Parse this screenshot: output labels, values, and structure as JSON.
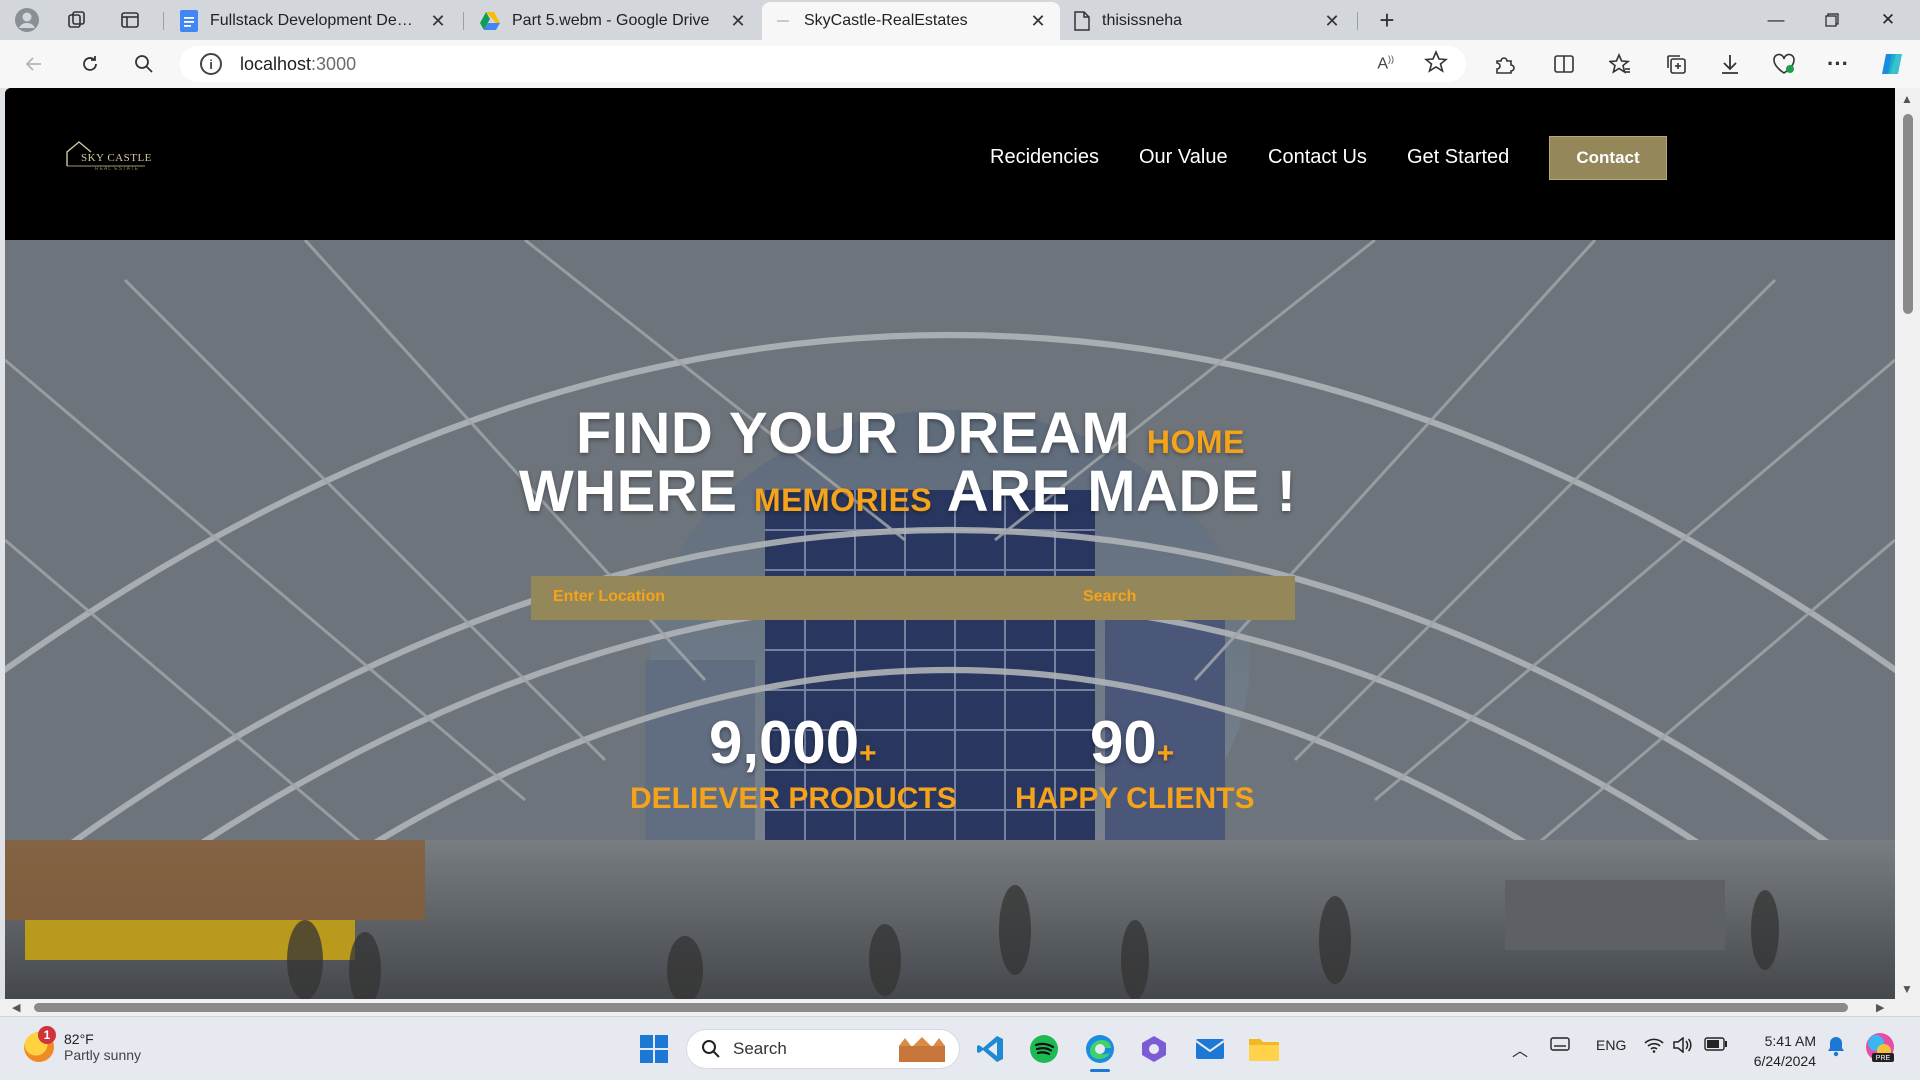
{
  "browser": {
    "tabs": [
      {
        "title": "Fullstack Development Desi QnA",
        "icon": "google-docs-icon"
      },
      {
        "title": "Part 5.webm - Google Drive",
        "icon": "google-drive-icon"
      },
      {
        "title": "SkyCastle-RealEstates",
        "icon": "page-loading-icon",
        "active": true
      },
      {
        "title": "thisissneha",
        "icon": "document-icon"
      }
    ],
    "address": {
      "host": "localhost",
      "port": ":3000"
    }
  },
  "site": {
    "logo": {
      "name": "SKY CASTLE",
      "tagline": "REAL ESTATE"
    },
    "nav": [
      "Recidencies",
      "Our Value",
      "Contact Us",
      "Get Started"
    ],
    "contact_button": "Contact",
    "hero": {
      "line1": "FIND YOUR DREAM",
      "line1_accent": "HOME",
      "line2_start": "WHERE",
      "line2_accent": "MEMORIES",
      "line2_end": "ARE MADE !",
      "search_placeholder": "Enter Location",
      "search_button": "Search"
    },
    "stats": [
      {
        "value": "9,000",
        "plus": "+",
        "label": "DELIEVER PRODUCTS"
      },
      {
        "value": "90",
        "plus": "+",
        "label": "HAPPY CLIENTS"
      }
    ],
    "colors": {
      "accent": "#f5a31a",
      "gold": "#94875a",
      "header": "#000000"
    }
  },
  "taskbar": {
    "weather": {
      "temp": "82°F",
      "condition": "Partly sunny",
      "badge": "1"
    },
    "search_label": "Search",
    "language": "ENG",
    "time": "5:41 AM",
    "date": "6/24/2024"
  }
}
